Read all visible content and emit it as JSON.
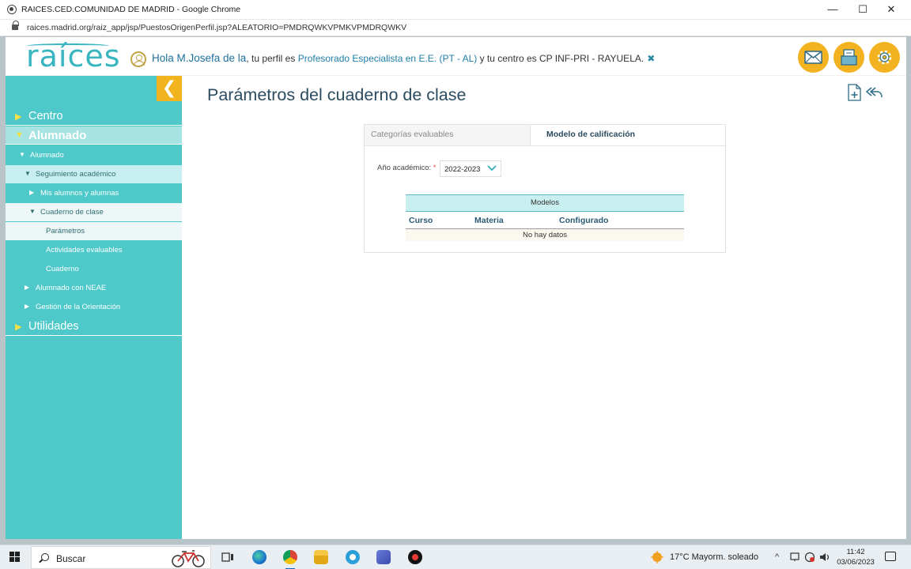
{
  "browser": {
    "window_title": "RAICES.CED.COMUNIDAD DE MADRID - Google Chrome",
    "url": "raices.madrid.org/raiz_app/jsp/PuestosOrigenPerfil.jsp?ALEATORIO=PMDRQWKVPMKVPMDRQWKV",
    "minimize": "—",
    "maximize": "☐",
    "close": "✕"
  },
  "header": {
    "logo": "raíces",
    "greeting_hello": "Hola M.Josefa de la",
    "greeting_profile_prefix": ", tu perfil es ",
    "profile": "Profesorado Especialista en E.E. (PT - AL)",
    "greeting_center_prefix": " y tu centro es ",
    "center": "CP INF-PRI - RAYUELA.",
    "close_symbol": "✖"
  },
  "sidebar": {
    "collapse_symbol": "❮",
    "items": [
      {
        "label": "Centro"
      },
      {
        "label": "Alumnado"
      },
      {
        "label": "Alumnado"
      },
      {
        "label": "Seguimiento académico"
      },
      {
        "label": "Mis alumnos y alumnas"
      },
      {
        "label": "Cuaderno de clase"
      },
      {
        "label": "Parámetros"
      },
      {
        "label": "Actividades evaluables"
      },
      {
        "label": "Cuaderno"
      },
      {
        "label": "Alumnado con NEAE"
      },
      {
        "label": "Gestión de la Orientación"
      },
      {
        "label": "Utilidades"
      }
    ],
    "arrow_right": "▶",
    "arrow_down": "▼"
  },
  "main": {
    "title": "Parámetros del cuaderno de clase",
    "tabs": [
      {
        "label": "Categorías evaluables"
      },
      {
        "label": "Modelo de calificación"
      }
    ],
    "year_label": "Año académico:",
    "required_mark": "*",
    "year_value": "2022-2023",
    "table": {
      "title": "Modelos",
      "columns": [
        "Curso",
        "Materia",
        "Configurado"
      ],
      "empty_text": "No hay datos"
    }
  },
  "taskbar": {
    "search_placeholder": "Buscar",
    "weather": "17°C  Mayorm. soleado",
    "time": "11:42",
    "date": "03/06/2023",
    "tray_chevron": "^"
  }
}
